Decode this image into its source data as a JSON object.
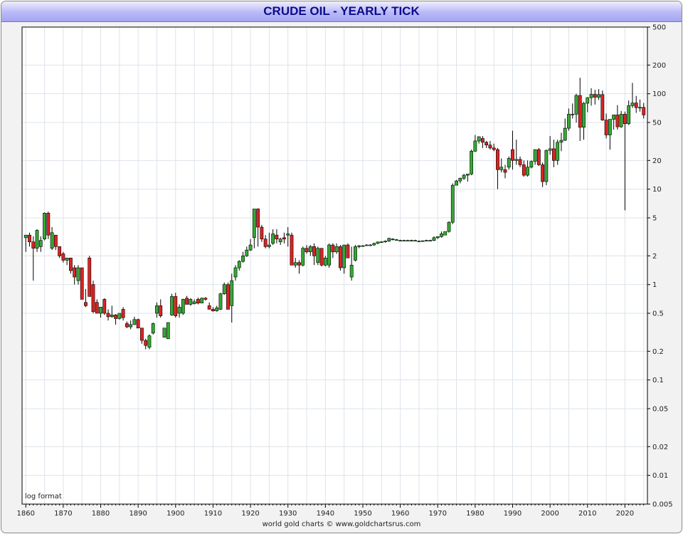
{
  "chart_data": {
    "type": "candlestick",
    "title": "CRUDE OIL - YEARLY TICK",
    "scale": "log",
    "scale_label": "log format",
    "source": "world gold charts © www.goldchartsrus.com",
    "x_range": [
      1859,
      2026
    ],
    "ylim": [
      0.005,
      500
    ],
    "x_ticks": [
      1860,
      1870,
      1880,
      1890,
      1900,
      1910,
      1920,
      1930,
      1940,
      1950,
      1960,
      1970,
      1980,
      1990,
      2000,
      2010,
      2020
    ],
    "y_ticks": [
      {
        "value": 500,
        "label": "500"
      },
      {
        "value": 200,
        "label": "200"
      },
      {
        "value": 100,
        "label": "100"
      },
      {
        "value": 50,
        "label": "50"
      },
      {
        "value": 20,
        "label": "20"
      },
      {
        "value": 10,
        "label": "10"
      },
      {
        "value": 5,
        "label": "5"
      },
      {
        "value": 2,
        "label": "2"
      },
      {
        "value": 1,
        "label": "1"
      },
      {
        "value": 0.5,
        "label": "0.5"
      },
      {
        "value": 0.2,
        "label": "0.2"
      },
      {
        "value": 0.1,
        "label": "0.1"
      },
      {
        "value": 0.05,
        "label": "0.05"
      },
      {
        "value": 0.02,
        "label": "0.02"
      },
      {
        "value": 0.01,
        "label": "0.01"
      },
      {
        "value": 0.005,
        "label": "0.005"
      }
    ],
    "grid": true,
    "colors": {
      "up": "#33aa33",
      "down": "#dd2222",
      "outline": "#000000",
      "grid": "#dde3ea",
      "plot_bg": "#ffffff"
    },
    "candles": [
      [
        1860,
        3.1,
        3.3,
        2.2,
        3.3
      ],
      [
        1861,
        3.3,
        3.5,
        2.5,
        2.8
      ],
      [
        1862,
        2.8,
        3.2,
        1.1,
        2.4
      ],
      [
        1863,
        2.4,
        3.8,
        2.2,
        3.7
      ],
      [
        1864,
        2.5,
        3.2,
        2.2,
        2.9
      ],
      [
        1865,
        3.0,
        5.7,
        2.9,
        5.6
      ],
      [
        1866,
        5.6,
        5.8,
        3.0,
        3.3
      ],
      [
        1867,
        2.4,
        4.0,
        2.3,
        3.5
      ],
      [
        1868,
        3.3,
        3.3,
        2.3,
        2.5
      ],
      [
        1869,
        2.5,
        2.5,
        1.9,
        2.0
      ],
      [
        1870,
        2.1,
        2.2,
        1.7,
        1.8
      ],
      [
        1871,
        1.8,
        1.9,
        1.6,
        1.9
      ],
      [
        1872,
        1.9,
        1.9,
        1.3,
        1.4
      ],
      [
        1873,
        1.5,
        1.6,
        1.0,
        1.2
      ],
      [
        1874,
        1.1,
        1.6,
        1.0,
        1.5
      ],
      [
        1875,
        1.5,
        1.5,
        0.8,
        0.7
      ],
      [
        1876,
        0.65,
        0.9,
        0.58,
        0.6
      ],
      [
        1877,
        1.9,
        2.0,
        0.75,
        0.75
      ],
      [
        1878,
        1.0,
        1.1,
        0.5,
        0.52
      ],
      [
        1879,
        0.65,
        0.7,
        0.5,
        0.5
      ],
      [
        1880,
        0.5,
        0.58,
        0.45,
        0.58
      ],
      [
        1881,
        0.7,
        0.72,
        0.48,
        0.5
      ],
      [
        1882,
        0.5,
        0.55,
        0.42,
        0.46
      ],
      [
        1883,
        0.46,
        0.6,
        0.45,
        0.48
      ],
      [
        1884,
        0.48,
        0.49,
        0.38,
        0.44
      ],
      [
        1885,
        0.44,
        0.5,
        0.43,
        0.5
      ],
      [
        1886,
        0.55,
        0.58,
        0.42,
        0.45
      ],
      [
        1887,
        0.39,
        0.41,
        0.35,
        0.36
      ],
      [
        1888,
        0.36,
        0.42,
        0.34,
        0.38
      ],
      [
        1889,
        0.38,
        0.46,
        0.38,
        0.43
      ],
      [
        1890,
        0.43,
        0.44,
        0.35,
        0.35
      ],
      [
        1891,
        0.35,
        0.35,
        0.24,
        0.26
      ],
      [
        1892,
        0.26,
        0.27,
        0.21,
        0.23
      ],
      [
        1893,
        0.22,
        0.3,
        0.21,
        0.29
      ],
      [
        1894,
        0.31,
        0.4,
        0.3,
        0.39
      ],
      [
        1895,
        0.5,
        0.65,
        0.45,
        0.6
      ],
      [
        1896,
        0.6,
        0.7,
        0.45,
        0.47
      ],
      [
        1897,
        0.28,
        0.35,
        0.28,
        0.35
      ],
      [
        1898,
        0.27,
        0.4,
        0.27,
        0.4
      ],
      [
        1899,
        0.48,
        0.8,
        0.47,
        0.75
      ],
      [
        1900,
        0.75,
        0.82,
        0.45,
        0.47
      ],
      [
        1901,
        0.5,
        0.62,
        0.45,
        0.58
      ],
      [
        1902,
        0.5,
        0.71,
        0.48,
        0.7
      ],
      [
        1903,
        0.72,
        0.76,
        0.62,
        0.62
      ],
      [
        1904,
        0.62,
        0.72,
        0.6,
        0.7
      ],
      [
        1905,
        0.63,
        0.7,
        0.62,
        0.66
      ],
      [
        1906,
        0.7,
        0.73,
        0.62,
        0.64
      ],
      [
        1907,
        0.64,
        0.73,
        0.64,
        0.72
      ],
      [
        1908,
        0.72,
        0.74,
        0.68,
        0.7
      ],
      [
        1909,
        0.6,
        0.65,
        0.55,
        0.55
      ],
      [
        1910,
        0.55,
        0.58,
        0.52,
        0.53
      ],
      [
        1911,
        0.53,
        0.6,
        0.52,
        0.57
      ],
      [
        1912,
        0.55,
        0.82,
        0.54,
        0.8
      ],
      [
        1913,
        0.8,
        1.05,
        0.78,
        1.0
      ],
      [
        1914,
        1.0,
        1.05,
        0.55,
        0.55
      ],
      [
        1915,
        0.6,
        1.3,
        0.4,
        1.1
      ],
      [
        1916,
        1.2,
        1.6,
        1.1,
        1.5
      ],
      [
        1917,
        1.5,
        1.8,
        1.4,
        1.75
      ],
      [
        1918,
        1.75,
        2.2,
        1.7,
        2.0
      ],
      [
        1919,
        2.0,
        2.5,
        1.95,
        2.3
      ],
      [
        1920,
        2.3,
        3.0,
        2.25,
        2.6
      ],
      [
        1921,
        3.1,
        3.6,
        2.4,
        6.2
      ],
      [
        1922,
        6.2,
        6.3,
        2.5,
        4.0
      ],
      [
        1923,
        4.0,
        4.2,
        2.8,
        3.0
      ],
      [
        1924,
        3.0,
        3.3,
        2.4,
        2.5
      ],
      [
        1925,
        2.5,
        3.5,
        2.4,
        2.6
      ],
      [
        1926,
        2.7,
        3.8,
        2.6,
        3.4
      ],
      [
        1927,
        3.3,
        3.8,
        2.7,
        3.0
      ],
      [
        1928,
        2.8,
        3.1,
        2.6,
        3.0
      ],
      [
        1929,
        3.1,
        3.5,
        2.7,
        3.0
      ],
      [
        1930,
        3.3,
        4.0,
        2.5,
        3.4
      ],
      [
        1931,
        3.3,
        3.5,
        1.6,
        1.6
      ],
      [
        1932,
        1.6,
        1.9,
        1.5,
        1.7
      ],
      [
        1933,
        1.7,
        1.8,
        1.3,
        1.6
      ],
      [
        1934,
        1.6,
        2.5,
        1.55,
        2.4
      ],
      [
        1935,
        2.4,
        2.6,
        2.1,
        2.2
      ],
      [
        1936,
        2.2,
        2.6,
        2.0,
        2.5
      ],
      [
        1937,
        2.5,
        2.7,
        1.6,
        2.0
      ],
      [
        1938,
        1.7,
        2.5,
        1.6,
        2.4
      ],
      [
        1939,
        2.4,
        2.4,
        1.55,
        1.6
      ],
      [
        1940,
        1.6,
        2.0,
        1.55,
        1.9
      ],
      [
        1941,
        1.6,
        2.7,
        1.5,
        2.6
      ],
      [
        1942,
        2.6,
        2.7,
        1.9,
        2.2
      ],
      [
        1943,
        2.2,
        2.7,
        2.1,
        2.5
      ],
      [
        1944,
        2.5,
        2.6,
        1.4,
        1.5
      ],
      [
        1945,
        1.5,
        2.6,
        1.3,
        2.6
      ],
      [
        1946,
        2.6,
        2.7,
        2.0,
        1.9
      ],
      [
        1947,
        1.2,
        2.5,
        1.1,
        1.6
      ],
      [
        1948,
        1.8,
        2.6,
        1.75,
        2.5
      ],
      [
        1949,
        2.5,
        2.6,
        2.4,
        2.55
      ],
      [
        1950,
        2.55,
        2.6,
        2.5,
        2.55
      ],
      [
        1951,
        2.6,
        2.65,
        2.55,
        2.6
      ],
      [
        1952,
        2.6,
        2.65,
        2.55,
        2.6
      ],
      [
        1953,
        2.6,
        2.75,
        2.55,
        2.7
      ],
      [
        1954,
        2.7,
        2.8,
        2.65,
        2.8
      ],
      [
        1955,
        2.8,
        2.85,
        2.75,
        2.8
      ],
      [
        1956,
        2.8,
        2.9,
        2.75,
        2.85
      ],
      [
        1957,
        2.85,
        3.1,
        2.8,
        3.05
      ],
      [
        1958,
        3.0,
        3.05,
        2.9,
        2.95
      ],
      [
        1959,
        2.95,
        3.0,
        2.9,
        2.95
      ],
      [
        1960,
        2.9,
        2.95,
        2.85,
        2.9
      ],
      [
        1961,
        2.9,
        2.95,
        2.85,
        2.9
      ],
      [
        1962,
        2.9,
        2.95,
        2.85,
        2.9
      ],
      [
        1963,
        2.9,
        2.95,
        2.85,
        2.9
      ],
      [
        1964,
        2.9,
        2.95,
        2.85,
        2.9
      ],
      [
        1965,
        2.85,
        2.9,
        2.8,
        2.85
      ],
      [
        1966,
        2.85,
        2.9,
        2.8,
        2.88
      ],
      [
        1967,
        2.88,
        2.95,
        2.85,
        2.9
      ],
      [
        1968,
        2.9,
        2.95,
        2.85,
        2.9
      ],
      [
        1969,
        2.9,
        3.2,
        2.85,
        3.1
      ],
      [
        1970,
        3.1,
        3.2,
        3.0,
        3.18
      ],
      [
        1971,
        3.18,
        3.6,
        3.1,
        3.4
      ],
      [
        1972,
        3.3,
        3.6,
        3.3,
        3.6
      ],
      [
        1973,
        3.6,
        4.6,
        3.5,
        4.5
      ],
      [
        1974,
        4.5,
        11.5,
        4.3,
        11.0
      ],
      [
        1975,
        11.0,
        12.5,
        11.0,
        12.2
      ],
      [
        1976,
        12.2,
        13.2,
        11.5,
        13.0
      ],
      [
        1977,
        13.0,
        14.5,
        12.5,
        14.0
      ],
      [
        1978,
        14.0,
        14.5,
        12.0,
        14.4
      ],
      [
        1979,
        14.4,
        26.0,
        14.0,
        25.0
      ],
      [
        1980,
        25.0,
        37.0,
        24.5,
        32.0
      ],
      [
        1981,
        32.0,
        35.0,
        30.0,
        35.5
      ],
      [
        1982,
        34.0,
        36.0,
        27.0,
        31.0
      ],
      [
        1983,
        31.0,
        32.0,
        27.0,
        29.0
      ],
      [
        1984,
        29.0,
        32.0,
        26.0,
        27.0
      ],
      [
        1985,
        27.0,
        30.0,
        25.0,
        26.0
      ],
      [
        1986,
        26.0,
        27.0,
        10.0,
        16.0
      ],
      [
        1987,
        16.0,
        21.0,
        15.0,
        17.0
      ],
      [
        1988,
        16.0,
        18.0,
        13.0,
        15.0
      ],
      [
        1989,
        17.0,
        22.0,
        16.0,
        21.0
      ],
      [
        1990,
        26.0,
        41.0,
        16.0,
        20.0
      ],
      [
        1991,
        20.0,
        33.0,
        18.0,
        20.5
      ],
      [
        1992,
        20.5,
        22.0,
        17.0,
        18.0
      ],
      [
        1993,
        18.0,
        20.0,
        13.5,
        14.0
      ],
      [
        1994,
        14.0,
        20.0,
        13.5,
        17.0
      ],
      [
        1995,
        17.0,
        20.0,
        16.5,
        19.5
      ],
      [
        1996,
        19.5,
        26.0,
        18.0,
        26.0
      ],
      [
        1997,
        26.0,
        27.0,
        17.5,
        18.0
      ],
      [
        1998,
        18.0,
        19.0,
        10.5,
        12.0
      ],
      [
        1999,
        12.0,
        26.0,
        11.0,
        25.5
      ],
      [
        2000,
        25.5,
        36.0,
        23.0,
        26.5
      ],
      [
        2001,
        26.5,
        33.0,
        17.0,
        20.0
      ],
      [
        2002,
        20.0,
        33.0,
        18.0,
        31.0
      ],
      [
        2003,
        31.0,
        39.0,
        25.0,
        32.5
      ],
      [
        2004,
        32.5,
        55.0,
        32.0,
        43.5
      ],
      [
        2005,
        43.5,
        70.0,
        41.0,
        61.0
      ],
      [
        2006,
        61.0,
        79.0,
        55.0,
        61.0
      ],
      [
        2007,
        61.0,
        100.0,
        50.0,
        96.0
      ],
      [
        2008,
        96.0,
        147.0,
        32.0,
        44.5
      ],
      [
        2009,
        44.5,
        82.0,
        33.0,
        79.5
      ],
      [
        2010,
        79.5,
        92.0,
        64.0,
        91.0
      ],
      [
        2011,
        91.0,
        114.0,
        75.0,
        98.5
      ],
      [
        2012,
        98.5,
        110.0,
        77.0,
        92.0
      ],
      [
        2013,
        92.0,
        112.0,
        86.0,
        98.0
      ],
      [
        2014,
        98.0,
        108.0,
        52.0,
        53.0
      ],
      [
        2015,
        53.0,
        62.0,
        34.0,
        37.0
      ],
      [
        2016,
        37.0,
        54.0,
        26.0,
        54.0
      ],
      [
        2017,
        54.0,
        60.0,
        42.0,
        60.0
      ],
      [
        2018,
        60.0,
        76.0,
        42.0,
        45.0
      ],
      [
        2019,
        45.0,
        66.0,
        44.0,
        61.0
      ],
      [
        2020,
        61.0,
        65.0,
        6.0,
        48.5
      ],
      [
        2021,
        48.5,
        85.0,
        47.0,
        75.0
      ],
      [
        2022,
        75.0,
        130.0,
        71.0,
        80.0
      ],
      [
        2023,
        80.0,
        95.0,
        63.0,
        71.5
      ],
      [
        2024,
        71.5,
        87.0,
        65.0,
        72.0
      ],
      [
        2025,
        72.0,
        80.0,
        55.0,
        60.0
      ]
    ]
  }
}
